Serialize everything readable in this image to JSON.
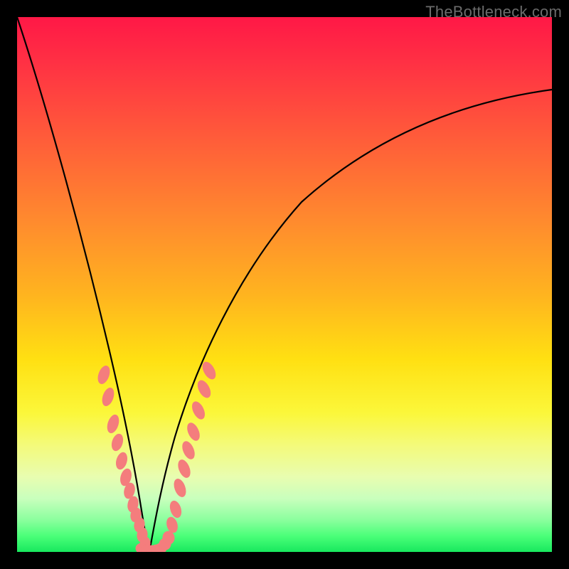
{
  "watermark": "TheBottleneck.com",
  "chart_data": {
    "type": "line",
    "title": "",
    "xlabel": "",
    "ylabel": "",
    "xlim": [
      0,
      100
    ],
    "ylim": [
      0,
      100
    ],
    "grid": false,
    "legend": false,
    "background_gradient": {
      "direction": "top-to-bottom",
      "stops": [
        {
          "pos": 0,
          "color": "#ff1846",
          "meaning": "worst"
        },
        {
          "pos": 50,
          "color": "#ffd11a",
          "meaning": "mid"
        },
        {
          "pos": 100,
          "color": "#18e85e",
          "meaning": "best"
        }
      ]
    },
    "series": [
      {
        "name": "left-branch",
        "color": "#000000",
        "x": [
          0,
          2,
          4,
          6,
          8,
          10,
          12,
          14,
          16,
          18,
          20,
          21,
          22,
          23,
          24
        ],
        "y": [
          100,
          92,
          84,
          76,
          68,
          60,
          51,
          42,
          33,
          24,
          14,
          9,
          5,
          2,
          0
        ]
      },
      {
        "name": "right-branch",
        "color": "#000000",
        "x": [
          24,
          25,
          26,
          28,
          30,
          34,
          40,
          48,
          58,
          70,
          84,
          100
        ],
        "y": [
          0,
          2,
          5,
          12,
          20,
          33,
          48,
          60,
          70,
          78,
          83,
          86
        ]
      },
      {
        "name": "markers-left",
        "type": "scatter",
        "color": "#f47d7d",
        "x": [
          16.0,
          16.8,
          17.8,
          18.5,
          19.3,
          20.0,
          20.6,
          21.2,
          21.8,
          22.4,
          23.0,
          23.6
        ],
        "y": [
          33.0,
          29.0,
          24.0,
          20.5,
          17.0,
          14.0,
          11.5,
          9.0,
          7.0,
          5.0,
          3.0,
          1.5
        ]
      },
      {
        "name": "markers-bottom",
        "type": "scatter",
        "color": "#f47d7d",
        "x": [
          23.2,
          23.8,
          24.4,
          25.0,
          25.6,
          26.2,
          26.8
        ],
        "y": [
          0.8,
          0.4,
          0.2,
          0.2,
          0.6,
          1.4,
          2.6
        ]
      },
      {
        "name": "markers-right",
        "type": "scatter",
        "color": "#f47d7d",
        "x": [
          27.4,
          28.0,
          28.8,
          29.6,
          30.4,
          31.2,
          32.2,
          33.2,
          34.2
        ],
        "y": [
          5.0,
          8.0,
          12.0,
          15.5,
          19.0,
          22.5,
          26.5,
          30.5,
          34.0
        ]
      }
    ]
  }
}
